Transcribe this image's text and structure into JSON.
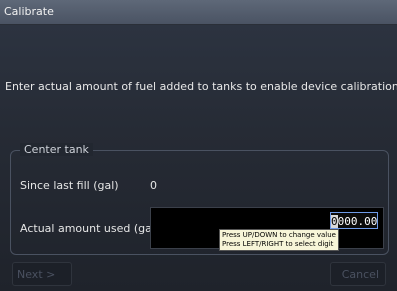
{
  "window": {
    "title": "Calibrate"
  },
  "instruction": "Enter actual amount of fuel added to tanks to enable device calibration.",
  "tank_group": {
    "legend": "Center tank",
    "since_last_fill_label": "Since last fill (gal)",
    "since_last_fill_value": "0",
    "actual_used_label": "Actual amount used (gal)",
    "actual_used_selected_digit": "0",
    "actual_used_rest": "000.00"
  },
  "tooltip": {
    "line1": "Press UP/DOWN to change value",
    "line2": "Press LEFT/RIGHT to select digit"
  },
  "buttons": {
    "next": "Next >",
    "cancel": "Cancel"
  },
  "colors": {
    "title_bar": "#5e6878",
    "input_focus_border": "#6f9be8",
    "tooltip_bg": "#f7f5d8"
  }
}
